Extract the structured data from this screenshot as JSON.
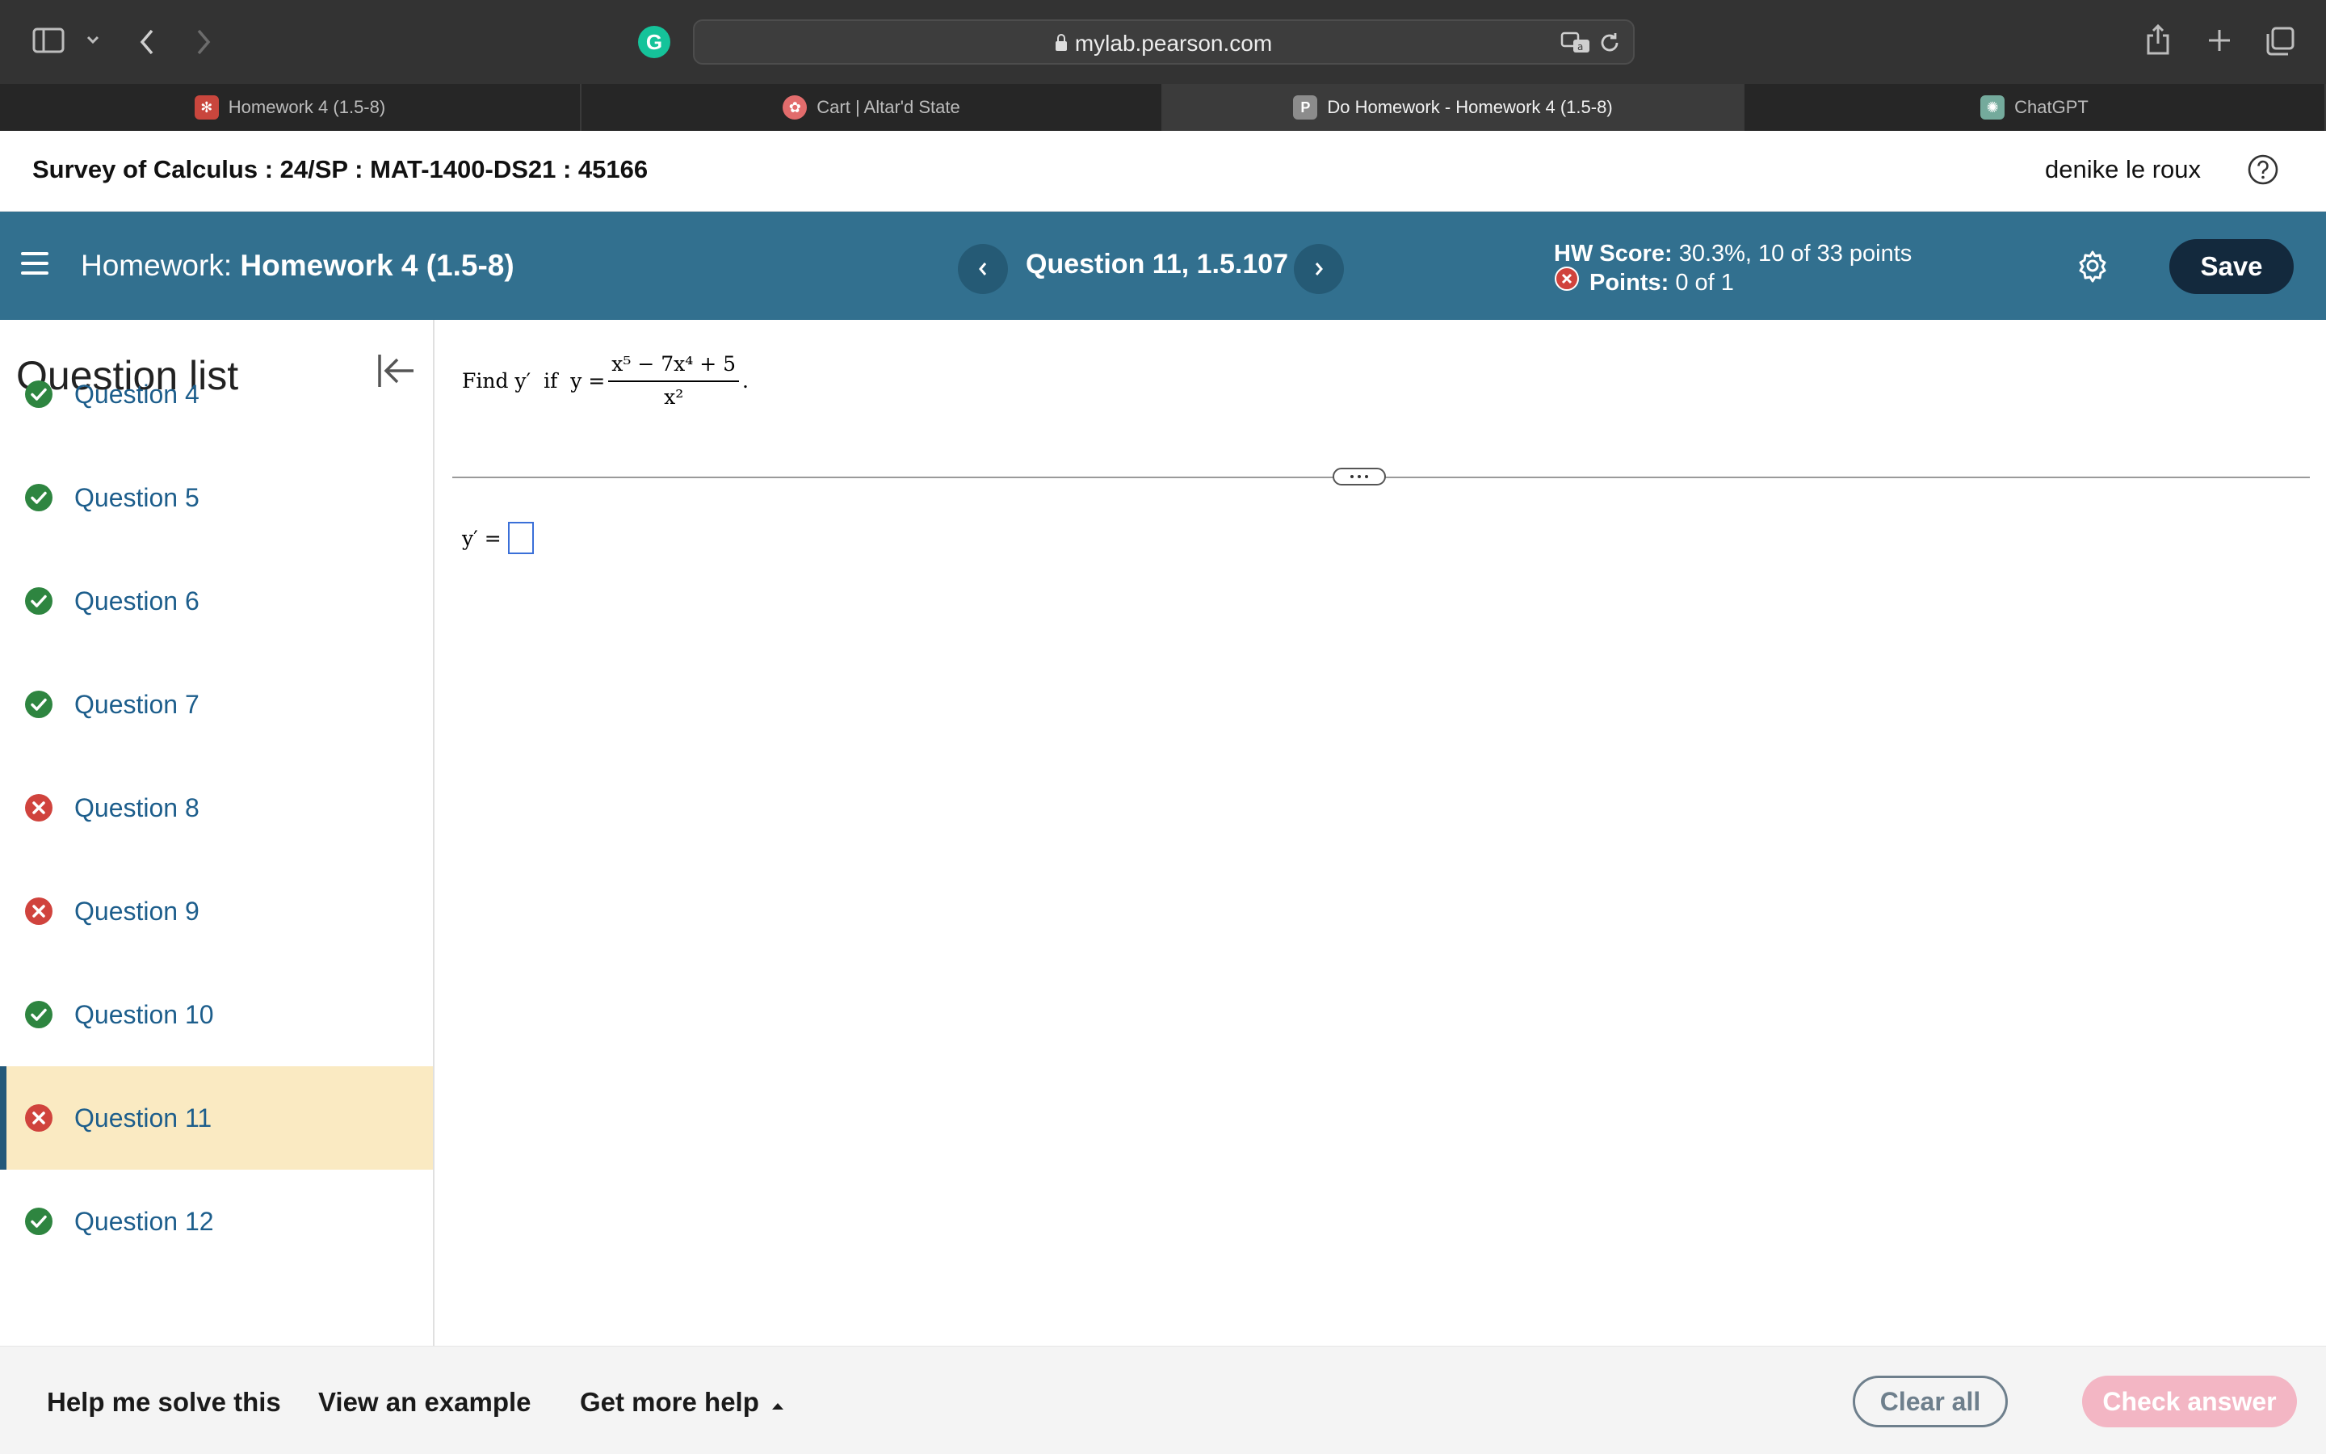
{
  "browser": {
    "url": "mylab.pearson.com",
    "tabs": [
      {
        "label": "Homework 4 (1.5-8)",
        "active": false
      },
      {
        "label": "Cart | Altar'd State",
        "active": false
      },
      {
        "label": "Do Homework - Homework 4 (1.5-8)",
        "active": true,
        "favicon": "P"
      },
      {
        "label": "ChatGPT",
        "active": false
      }
    ],
    "grammarly_icon": "G"
  },
  "header": {
    "course": "Survey of Calculus : 24/SP : MAT-1400-DS21 : 45166",
    "user": "denike le roux"
  },
  "hwbar": {
    "prefix": "Homework:",
    "title": "Homework 4 (1.5-8)",
    "question": "Question 11, 1.5.107",
    "score_label": "HW Score:",
    "score_value": "30.3%, 10 of 33 points",
    "points_label": "Points:",
    "points_value": "0 of 1",
    "save": "Save"
  },
  "sidebar": {
    "title": "Question list",
    "items": [
      {
        "label": "Question 4",
        "status": "correct"
      },
      {
        "label": "Question 5",
        "status": "correct"
      },
      {
        "label": "Question 6",
        "status": "correct"
      },
      {
        "label": "Question 7",
        "status": "correct"
      },
      {
        "label": "Question 8",
        "status": "incorrect"
      },
      {
        "label": "Question 9",
        "status": "incorrect"
      },
      {
        "label": "Question 10",
        "status": "correct"
      },
      {
        "label": "Question 11",
        "status": "incorrect",
        "current": true
      },
      {
        "label": "Question 12",
        "status": "correct"
      }
    ]
  },
  "question": {
    "prompt_find": "Find y′",
    "prompt_if": "if",
    "prompt_y": "y =",
    "numerator": "x⁵ − 7x⁴ + 5",
    "denominator": "x²",
    "answer_label": "y′ ="
  },
  "footer": {
    "help_solve": "Help me solve this",
    "view_example": "View an example",
    "more_help": "Get more help",
    "clear_all": "Clear all",
    "check_answer": "Check answer"
  },
  "colors": {
    "accent": "#32708f",
    "correct": "#2e8540",
    "incorrect": "#d0433d",
    "current_bg": "#faeac2"
  }
}
